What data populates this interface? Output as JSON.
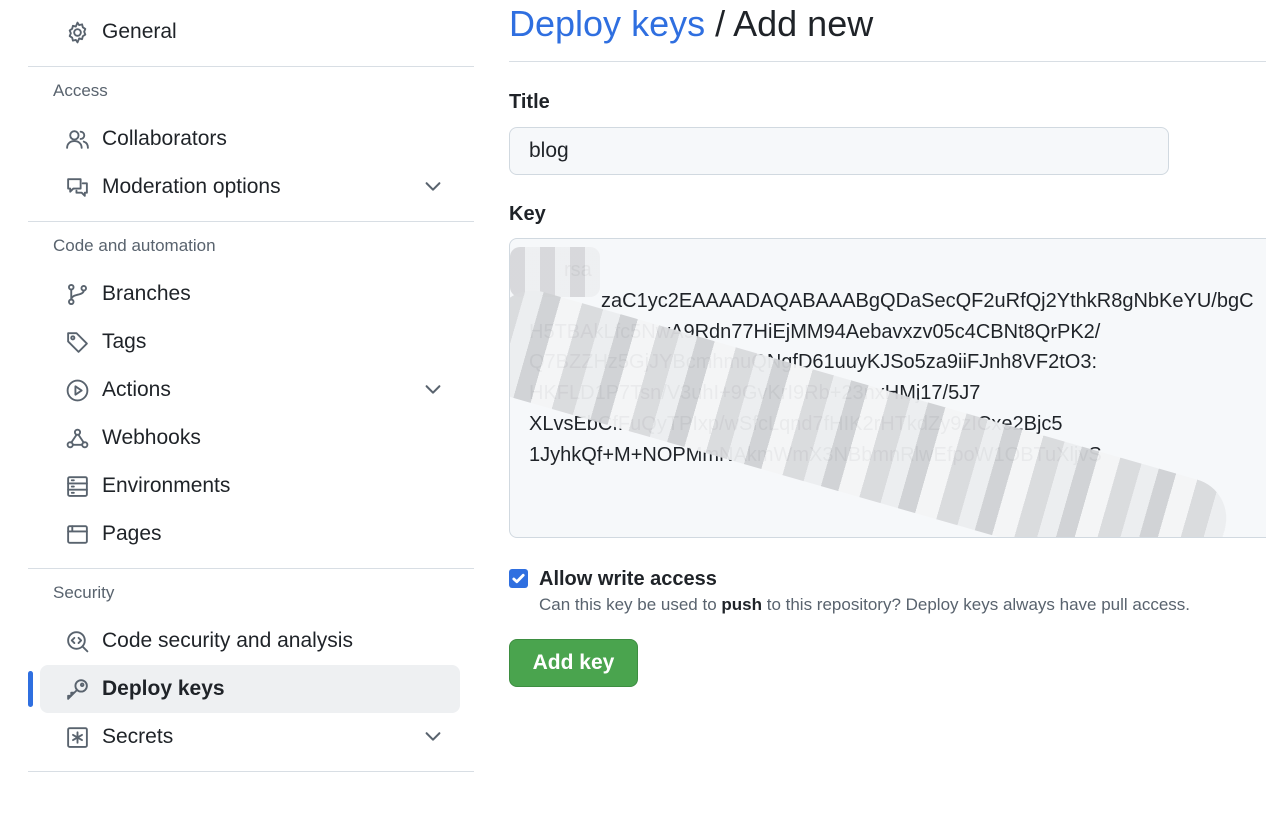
{
  "sidebar": {
    "general": "General",
    "sections": {
      "access": "Access",
      "code_automation": "Code and automation",
      "security": "Security"
    },
    "items": {
      "collaborators": "Collaborators",
      "moderation": "Moderation options",
      "branches": "Branches",
      "tags": "Tags",
      "actions": "Actions",
      "webhooks": "Webhooks",
      "environments": "Environments",
      "pages": "Pages",
      "code_security": "Code security and analysis",
      "deploy_keys": "Deploy keys",
      "secrets": "Secrets"
    },
    "active_item": "deploy_keys"
  },
  "main": {
    "breadcrumb": "Deploy keys",
    "separator": " / ",
    "title": "Add new",
    "title_label": "Title",
    "title_value": "blog",
    "key_label": "Key",
    "key_lines": [
      "rsa",
      "zaC1yc2EAAAADAQABAAABgQDaSecQF2uRfQj2YthkR8gNbKeYU/bgC",
      "H5TBAkLfc5NwA9Rdn77HiEjMM94Aebavxzv05c4CBNt8QrPK2/",
      "Q7BZZHz5GjJYBcmhmuQNgfD61uuyKJSo5za9iiFJnh8VF2tO3:",
      "HKFLD1P7Tsn/V3uhI+9GvKrI9Rb+23nxHMj17/5J7",
      "XLvsEbCfFuQyTPIxp/wSfcLqnd7fHIK2rHTkdZy9zICxe2Bjc5",
      "1JyhkQf+M+NOPMmNAkmWmX3NBbmnRlwEfpoW1OBTuXljvS"
    ],
    "allow_write": {
      "checked": true,
      "label": "Allow write access",
      "hint_before": "Can this key be used to ",
      "hint_bold": "push",
      "hint_after": " to this repository? Deploy keys always have pull access."
    },
    "submit_label": "Add key"
  },
  "colors": {
    "accent": "#2f6fe0",
    "button_green": "#4aa44e",
    "text": "#1f2328",
    "muted": "#59636e"
  }
}
